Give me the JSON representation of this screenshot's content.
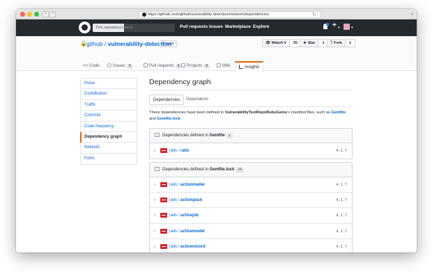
{
  "browser": {
    "url": "https://github.com/github/vulnerability-detection/network/dependencies",
    "nav_back": "<",
    "nav_forward": ">",
    "reload_glyph": "↻",
    "newtab_glyph": "+"
  },
  "header": {
    "search_scope": "This repository",
    "search_placeholder": "Search",
    "nav": [
      "Pull requests",
      "Issues",
      "Marketplace",
      "Explore"
    ],
    "plus_glyph": "+",
    "caret_glyph": "▾"
  },
  "repo": {
    "owner": "github",
    "separator": "/",
    "name": "vulnerability-detection",
    "private_label": "Private",
    "watch_label": "Watch",
    "watch_count": "35",
    "star_label": "Star",
    "star_count": "1",
    "fork_label": "Fork",
    "fork_count": "1",
    "tabs": [
      {
        "label": "Code",
        "count": ""
      },
      {
        "label": "Issues",
        "count": "0"
      },
      {
        "label": "Pull requests",
        "count": "0"
      },
      {
        "label": "Projects",
        "count": "0"
      },
      {
        "label": "Wiki",
        "count": ""
      },
      {
        "label": "Insights",
        "count": ""
      }
    ]
  },
  "sidebar": {
    "items": [
      "Pulse",
      "Contributors",
      "Traffic",
      "Commits",
      "Code frequency",
      "Dependency graph",
      "Network",
      "Forks"
    ],
    "selected": "Dependency graph"
  },
  "main": {
    "title": "Dependency graph",
    "tabs": [
      "Dependencies",
      "Dependents"
    ],
    "desc_prefix": "These dependencies have been defined in ",
    "desc_repo": "VulnerabilityTestRepoRubyGems",
    "desc_mid": "'s manifest files, such as ",
    "desc_file1": "Gemfile",
    "desc_and": "and",
    "desc_file2": "Gemfile.lock",
    "chevron": "›",
    "box1": {
      "prefix": "Dependencies defined in ",
      "file": "Gemfile",
      "count": "1",
      "rows": [
        {
          "owner": "rails",
          "sep": "/",
          "name": "rails",
          "version": "4.2.7"
        }
      ]
    },
    "box2": {
      "prefix": "Dependencies defined in ",
      "file": "Gemfile.lock",
      "count": "34",
      "rows": [
        {
          "owner": "rails",
          "sep": "/",
          "name": "actionmailer",
          "version": "4.2.7"
        },
        {
          "owner": "rails",
          "sep": "/",
          "name": "actionpack",
          "version": "4.2.7"
        },
        {
          "owner": "rails",
          "sep": "/",
          "name": "activejob",
          "version": "4.2.7"
        },
        {
          "owner": "rails",
          "sep": "/",
          "name": "activemodel",
          "version": "4.2.7"
        },
        {
          "owner": "rails",
          "sep": "/",
          "name": "activerecord",
          "version": "4.2.7"
        }
      ]
    }
  },
  "colors": {
    "header_bg": "#24292e",
    "link": "#0366d6",
    "accent_tab": "#e36209",
    "gem_red": "#d5242c",
    "traffic_red": "#fc5f57",
    "traffic_yellow": "#fdbc2e",
    "traffic_green": "#33c748"
  }
}
